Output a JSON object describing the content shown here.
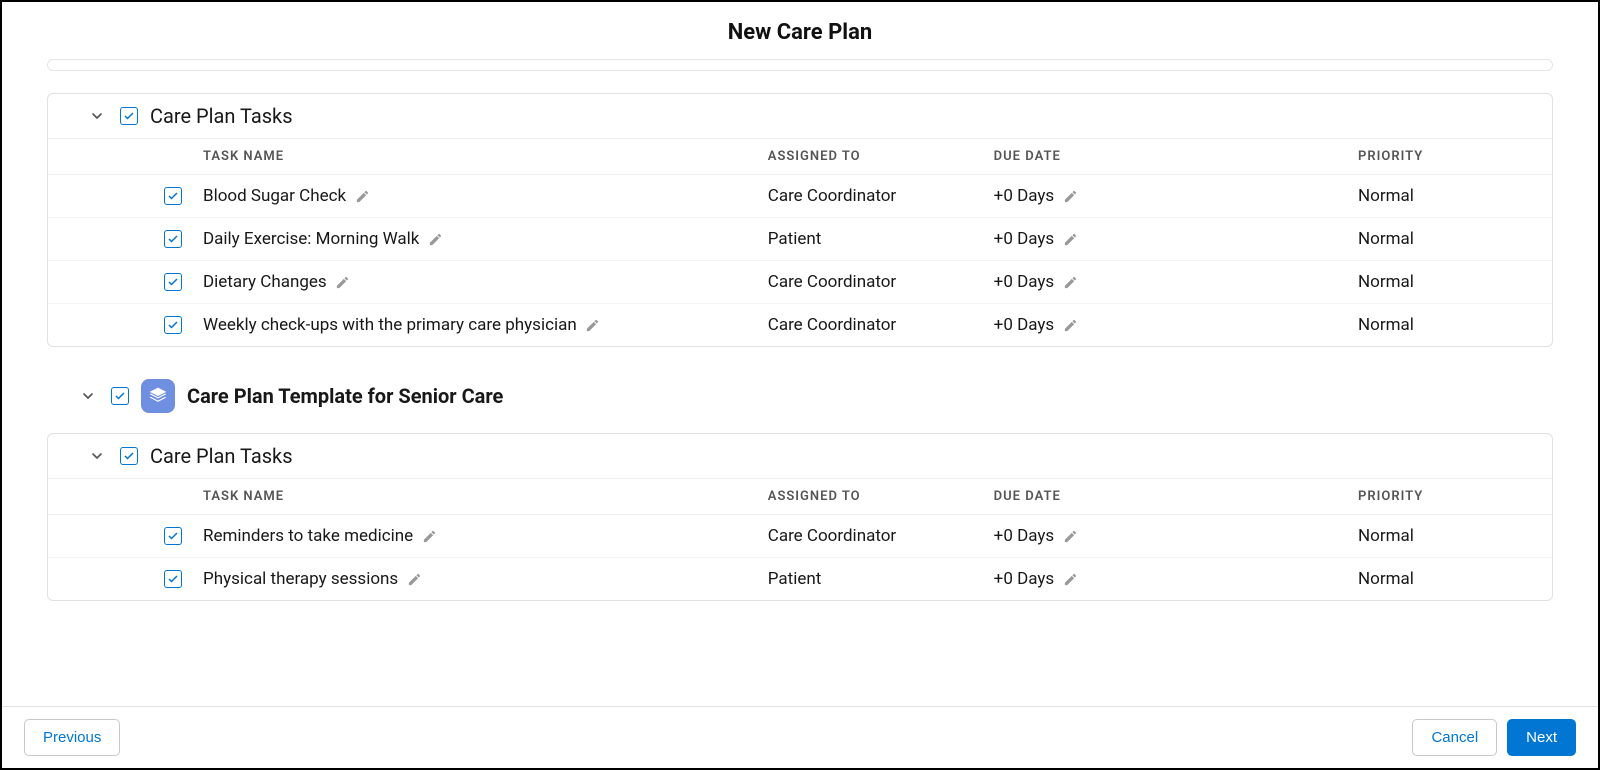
{
  "header": {
    "title": "New Care Plan"
  },
  "columns": {
    "task": "TASK NAME",
    "assigned": "ASSIGNED TO",
    "due": "DUE DATE",
    "priority": "PRIORITY"
  },
  "section1": {
    "title": "Care Plan Tasks",
    "rows": [
      {
        "name": "Blood Sugar Check",
        "assigned": "Care Coordinator",
        "due": "+0 Days",
        "priority": "Normal"
      },
      {
        "name": "Daily Exercise: Morning Walk",
        "assigned": "Patient",
        "due": "+0 Days",
        "priority": "Normal"
      },
      {
        "name": "Dietary Changes",
        "assigned": "Care Coordinator",
        "due": "+0 Days",
        "priority": "Normal"
      },
      {
        "name": "Weekly check-ups with the primary care physician",
        "assigned": "Care Coordinator",
        "due": "+0 Days",
        "priority": "Normal"
      }
    ]
  },
  "template2": {
    "title": "Care Plan Template for Senior Care"
  },
  "section2": {
    "title": "Care Plan Tasks",
    "rows": [
      {
        "name": "Reminders to take medicine",
        "assigned": "Care Coordinator",
        "due": "+0 Days",
        "priority": "Normal"
      },
      {
        "name": "Physical therapy sessions",
        "assigned": "Patient",
        "due": "+0 Days",
        "priority": "Normal"
      }
    ]
  },
  "footer": {
    "previous": "Previous",
    "cancel": "Cancel",
    "next": "Next"
  }
}
